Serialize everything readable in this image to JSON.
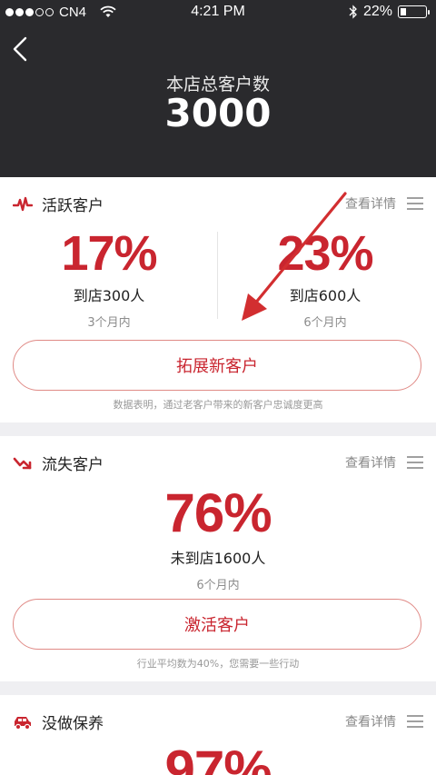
{
  "status_bar": {
    "carrier": "CN4",
    "time": "4:21 PM",
    "battery": "22%"
  },
  "header": {
    "label": "本店总客户数",
    "count": "3000"
  },
  "active": {
    "title": "活跃客户",
    "detail": "查看详情",
    "stat1": {
      "pct": "17%",
      "main": "到店300人",
      "sub": "3个月内"
    },
    "stat2": {
      "pct": "23%",
      "main": "到店600人",
      "sub": "6个月内"
    },
    "button": "拓展新客户",
    "note": "数据表明，通过老客户带来的新客户忠诚度更高"
  },
  "lost": {
    "title": "流失客户",
    "detail": "查看详情",
    "stat": {
      "pct": "76%",
      "main": "未到店1600人",
      "sub": "6个月内"
    },
    "button": "激活客户",
    "note": "行业平均数为40%，您需要一些行动"
  },
  "maintenance": {
    "title": "没做保养",
    "detail": "查看详情",
    "pct": "97%"
  },
  "colors": {
    "accent": "#c9252f",
    "header_bg": "#2a2a2d",
    "page_bg": "#efeff2"
  },
  "icons": [
    "wifi-icon",
    "bluetooth-icon",
    "battery-icon",
    "back-chevron-icon",
    "pulse-icon",
    "trend-down-icon",
    "car-icon",
    "menu-icon"
  ]
}
